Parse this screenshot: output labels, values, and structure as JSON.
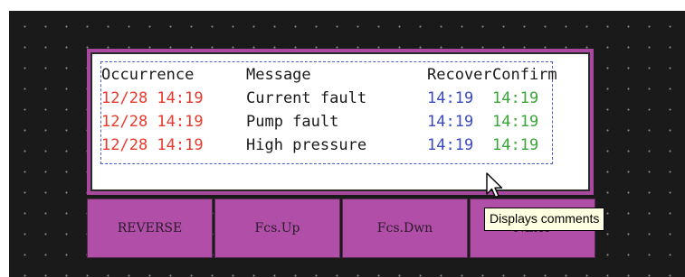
{
  "alarm_table": {
    "headers": [
      "Occurrence",
      "Message",
      "Recover",
      "Confirm"
    ],
    "rows": [
      {
        "occurrence": "12/28 14:19",
        "message": "Current fault",
        "recover": "14:19",
        "confirm": "14:19"
      },
      {
        "occurrence": "12/28 14:19",
        "message": "Pump fault",
        "recover": "14:19",
        "confirm": "14:19"
      },
      {
        "occurrence": "12/28 14:19",
        "message": "High pressure",
        "recover": "14:19",
        "confirm": "14:19"
      }
    ]
  },
  "buttons": [
    "REVERSE",
    "Fcs.Up",
    "Fcs.Dwn",
    "NEXT"
  ],
  "tooltip": "Displays comments",
  "colors": {
    "occurrence": "#e8392c",
    "recover": "#3b4bbf",
    "confirm": "#3aa637",
    "button": "#b14fa8",
    "background": "#1a1a1a"
  },
  "icons": {
    "cursor": "arrow-pointer-icon"
  }
}
